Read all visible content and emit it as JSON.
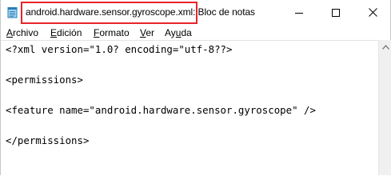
{
  "window": {
    "title": "android.hardware.sensor.gyroscope.xml",
    "app_name": ": Bloc de notas"
  },
  "titlebar": {
    "minimize_icon": "minimize-icon",
    "maximize_icon": "maximize-icon",
    "close_icon": "close-icon",
    "highlight_color": "#e8242a"
  },
  "menu": {
    "items": [
      {
        "first": "A",
        "rest": "rchivo"
      },
      {
        "first": "E",
        "rest": "dición"
      },
      {
        "first": "F",
        "rest": "ormato"
      },
      {
        "first": "V",
        "rest": "er"
      },
      {
        "pre": "Ay",
        "first": "u",
        "rest": "da"
      }
    ]
  },
  "editor": {
    "lines": [
      "<?xml version=\"1.0? encoding=\"utf-8??>",
      "",
      "<permissions>",
      "",
      "<feature name=\"android.hardware.sensor.gyroscope\" />",
      "",
      "</permissions>"
    ]
  }
}
